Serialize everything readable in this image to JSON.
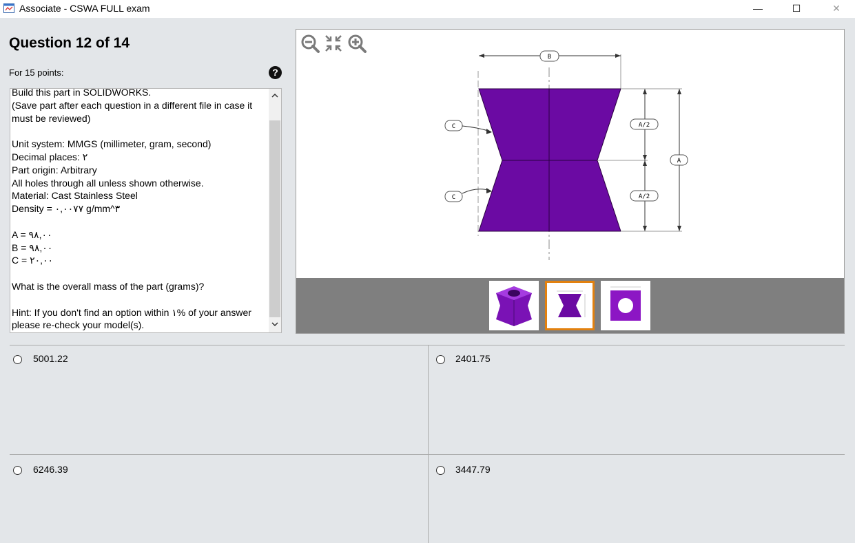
{
  "window": {
    "title": "Associate - CSWA FULL exam",
    "minimize_symbol": "—",
    "maximize_symbol": "☐",
    "close_symbol": "✕"
  },
  "question": {
    "title": "Question 12 of 14",
    "points": "For 15 points:",
    "help_symbol": "?",
    "text": "Build this part in SOLIDWORKS.\n(Save part after each question in a different file in case it must be reviewed)\n\nUnit system: MMGS (millimeter, gram, second)\nDecimal places: ٢\nPart origin: Arbitrary\nAll holes through all unless shown otherwise.\nMaterial: Cast Stainless Steel\nDensity = ٠,٠٠٧٧ g/mm^٣\n\nA = ٩٨,٠٠\nB = ٩٨,٠٠\nC = ٢٠,٠٠\n\nWhat is the overall mass of the part (grams)?\n\nHint: If you don't find an option within ١% of your answer please re-check your model(s).",
    "scroll_up_symbol": "▲",
    "scroll_down_symbol": "▼"
  },
  "viewer": {
    "toolbar_icons": [
      "zoom-out-icon",
      "fit-to-screen-icon",
      "zoom-in-icon"
    ],
    "drawing_labels": {
      "b": "B",
      "c_top": "C",
      "c_bottom": "C",
      "a_half_top": "A/2",
      "a_half_bottom": "A/2",
      "a": "A"
    },
    "part_color": "#6b0aa3",
    "thumbnails": [
      "isometric-view",
      "front-view",
      "top-view"
    ],
    "selected_thumbnail": 1,
    "selected_border_color": "#e2810f"
  },
  "answers": [
    {
      "label": "5001.22"
    },
    {
      "label": "2401.75"
    },
    {
      "label": "6246.39"
    },
    {
      "label": "3447.79"
    }
  ]
}
